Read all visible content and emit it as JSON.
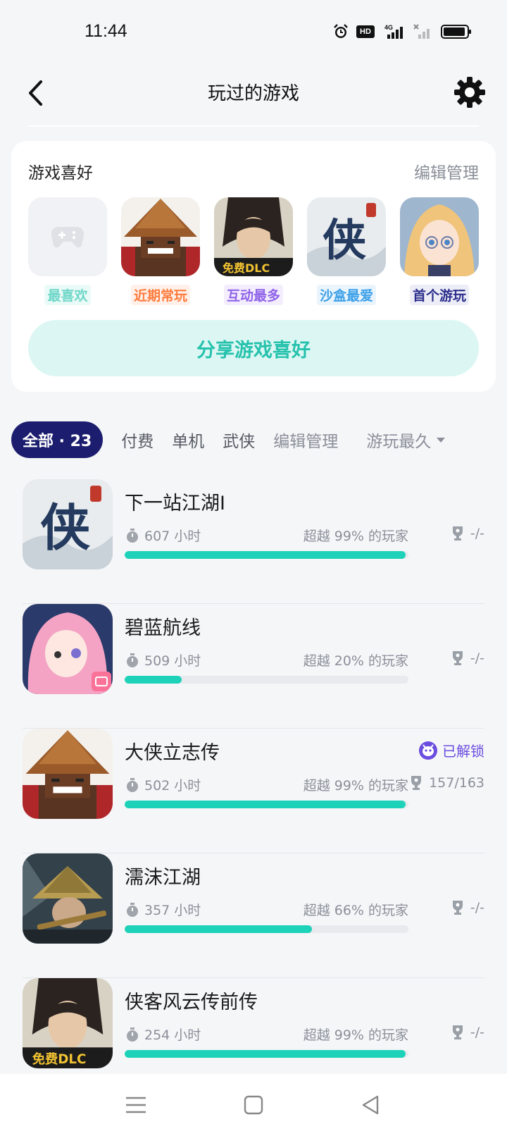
{
  "status_bar": {
    "time": "11:44",
    "network_label": "4G",
    "hd_label": "HD"
  },
  "header": {
    "title": "玩过的游戏"
  },
  "preferences": {
    "title": "游戏喜好",
    "edit_label": "编辑管理",
    "items": [
      {
        "label": "最喜欢",
        "color": "#6fd7c9",
        "bg": "#eafaf7"
      },
      {
        "label": "近期常玩",
        "color": "#ff7b3d",
        "bg": "#fff1ea"
      },
      {
        "label": "互动最多",
        "color": "#8f63e8",
        "bg": "#f3edfd"
      },
      {
        "label": "沙盒最爱",
        "color": "#3ca0e8",
        "bg": "#eaf4fd"
      },
      {
        "label": "首个游玩",
        "color": "#2b2e8c",
        "bg": "#ededf7"
      }
    ],
    "share_label": "分享游戏喜好"
  },
  "tabs": {
    "all_label": "全部 · 23",
    "items": [
      "付费",
      "单机",
      "武侠",
      "编辑管理"
    ],
    "sort_label": "游玩最久"
  },
  "games": [
    {
      "name": "下一站江湖Ⅰ",
      "hours": "607 小时",
      "beat": "超越 99% 的玩家",
      "trophy": "-/-",
      "progress": 0.99,
      "unlock": ""
    },
    {
      "name": "碧蓝航线",
      "hours": "509 小时",
      "beat": "超越 20% 的玩家",
      "trophy": "-/-",
      "progress": 0.2,
      "unlock": ""
    },
    {
      "name": "大侠立志传",
      "hours": "502 小时",
      "beat": "超越 99% 的玩家",
      "trophy": "157/163",
      "progress": 0.99,
      "unlock": "已解锁"
    },
    {
      "name": "濡沫江湖",
      "hours": "357 小时",
      "beat": "超越 66% 的玩家",
      "trophy": "-/-",
      "progress": 0.66,
      "unlock": ""
    },
    {
      "name": "侠客风云传前传",
      "hours": "254 小时",
      "beat": "超越 99% 的玩家",
      "trophy": "-/-",
      "progress": 0.99,
      "unlock": ""
    }
  ],
  "icons": {
    "status": [
      "alarm-icon",
      "hd-icon",
      "signal-4g-icon",
      "signal-off-icon",
      "battery-icon"
    ],
    "header": [
      "back-icon",
      "gear-icon"
    ],
    "nav": [
      "menu-icon",
      "home-icon",
      "back-triangle-icon"
    ]
  }
}
